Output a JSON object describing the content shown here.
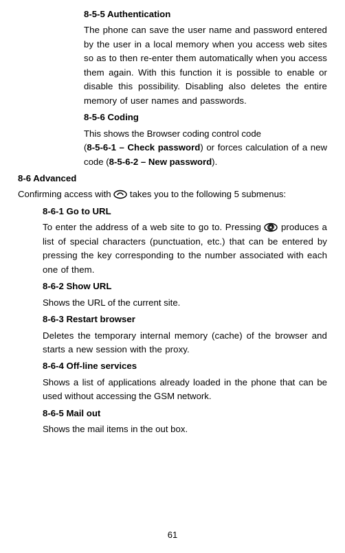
{
  "s855": {
    "heading": "8-5-5 Authentication",
    "body": "The phone can save the user name and password entered by the user in a local memory when you access web sites so as to then re-enter them automatically when you access them again. With this function it is possible to enable or disable this possibility. Disabling also deletes the entire memory of user names and passwords."
  },
  "s856": {
    "heading": "8-5-6 Coding",
    "line1": "This shows the Browser coding control code",
    "line2a": "(",
    "line2code1": "8-5-6-1 – Check password",
    "line2b": ") or forces calculation of a new code (",
    "line2code2": "8-5-6-2 – New password",
    "line2c": ")."
  },
  "s86": {
    "heading": "8-6 Advanced",
    "line_a": "Confirming access with ",
    "line_b": " takes you to the following 5 submenus:"
  },
  "s861": {
    "heading": "8-6-1 Go to URL",
    "body_a": "To enter the address of a web site to go to. Pressing ",
    "body_b": " produces a list of special characters (punctuation, etc.) that can be entered by pressing the key corresponding to the number associated with each one of them."
  },
  "s862": {
    "heading": "8-6-2 Show URL",
    "body": "Shows the URL of the current site."
  },
  "s863": {
    "heading": "8-6-3 Restart browser",
    "body": "Deletes the temporary internal memory (cache) of the browser and starts a new session with the proxy."
  },
  "s864": {
    "heading": "8-6-4 Off-line services",
    "body": "Shows a list of applications already loaded in the phone that can be used without accessing the GSM network."
  },
  "s865": {
    "heading": "8-6-5 Mail out",
    "body": "Shows the mail items in the out box."
  },
  "page_number": "61"
}
